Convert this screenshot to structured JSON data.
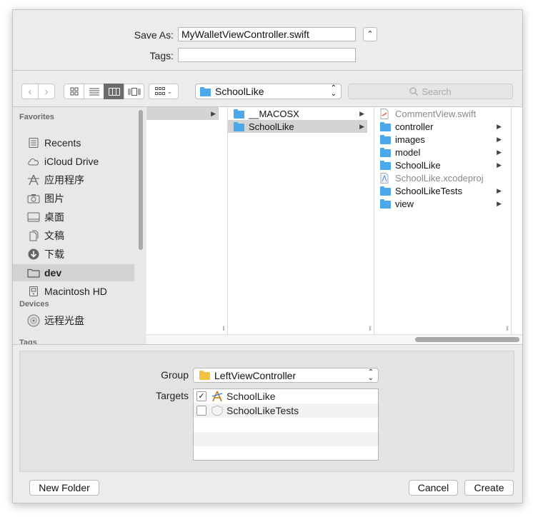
{
  "save": {
    "save_as_label": "Save As:",
    "filename": "MyWalletViewController.swift",
    "tags_label": "Tags:",
    "tags_value": ""
  },
  "toolbar": {
    "location": "SchoolLike",
    "search_placeholder": "Search"
  },
  "sidebar": {
    "favorites_header": "Favorites",
    "favorites": [
      {
        "label": "Recents",
        "icon": "recents-icon"
      },
      {
        "label": "iCloud Drive",
        "icon": "cloud-icon"
      },
      {
        "label": "应用程序",
        "icon": "applications-icon"
      },
      {
        "label": "图片",
        "icon": "camera-icon"
      },
      {
        "label": "桌面",
        "icon": "desktop-icon"
      },
      {
        "label": "文稿",
        "icon": "documents-icon"
      },
      {
        "label": "下载",
        "icon": "download-icon"
      },
      {
        "label": "dev",
        "icon": "folder-icon",
        "selected": true
      },
      {
        "label": "Macintosh HD",
        "icon": "hard-drive-icon"
      }
    ],
    "devices_header": "Devices",
    "devices": [
      {
        "label": "远程光盘",
        "icon": "disc-icon"
      }
    ],
    "tags_header": "Tags"
  },
  "browser": {
    "col2": [
      {
        "label": "__MACOSX",
        "folder": true,
        "arrow": true
      },
      {
        "label": "SchoolLike",
        "folder": true,
        "arrow": true,
        "selected": true
      }
    ],
    "col3": [
      {
        "label": "CommentView.swift",
        "folder": false,
        "dim": true,
        "icon": "swift-file-icon"
      },
      {
        "label": "controller",
        "folder": true,
        "arrow": true
      },
      {
        "label": "images",
        "folder": true,
        "arrow": true
      },
      {
        "label": "model",
        "folder": true,
        "arrow": true
      },
      {
        "label": "SchoolLike",
        "folder": true,
        "arrow": true
      },
      {
        "label": "SchoolLike.xcodeproj",
        "folder": false,
        "dim": true,
        "icon": "xcodeproj-file-icon"
      },
      {
        "label": "SchoolLikeTests",
        "folder": true,
        "arrow": true
      },
      {
        "label": "view",
        "folder": true,
        "arrow": true
      }
    ]
  },
  "options": {
    "group_label": "Group",
    "group_value": "LeftViewController",
    "targets_label": "Targets",
    "targets": [
      {
        "label": "SchoolLike",
        "checked": true,
        "icon": "app-target-icon"
      },
      {
        "label": "SchoolLikeTests",
        "checked": false,
        "icon": "test-target-icon"
      }
    ]
  },
  "buttons": {
    "new_folder": "New Folder",
    "cancel": "Cancel",
    "create": "Create"
  },
  "colors": {
    "accent_folder": "#4ba8ea",
    "group_folder": "#f1c33e"
  }
}
